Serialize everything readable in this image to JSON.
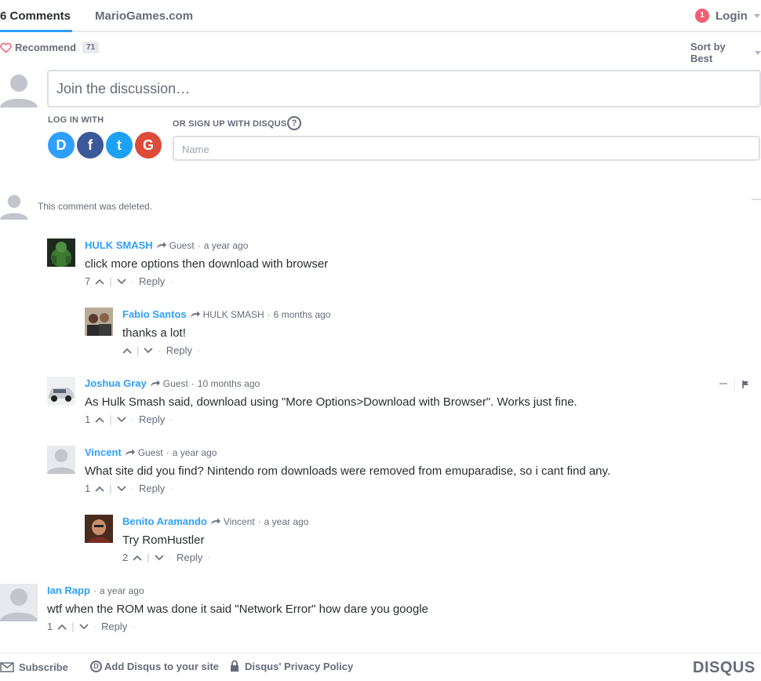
{
  "nav": {
    "comments_tab": "6 Comments",
    "site_tab": "MarioGames.com",
    "login_badge": "1",
    "login_label": "Login"
  },
  "toolbar": {
    "recommend_label": "Recommend",
    "recommend_count": "71",
    "sort_label": "Sort by Best"
  },
  "composer": {
    "placeholder": "Join the discussion…",
    "login_with": "LOG IN WITH",
    "signup_with": "OR SIGN UP WITH DISQUS",
    "help": "?",
    "name_placeholder": "Name",
    "social": [
      "D",
      "f",
      "t",
      "G"
    ]
  },
  "deleted": {
    "text": "This comment was deleted.",
    "collapse": "—"
  },
  "comments": [
    {
      "author": "HULK SMASH",
      "reply_to": "Guest",
      "time": "a year ago",
      "text": "click more options then download with browser",
      "votes": "7",
      "reply": "Reply"
    },
    {
      "author": "Fabio Santos",
      "reply_to": "HULK SMASH",
      "time": "6 months ago",
      "text": "thanks a lot!",
      "votes": "",
      "reply": "Reply"
    },
    {
      "author": "Joshua Gray",
      "reply_to": "Guest",
      "time": "10 months ago",
      "text": "As Hulk Smash said, download using \"More Options>Download with Browser\". Works just fine.",
      "votes": "1",
      "reply": "Reply"
    },
    {
      "author": "Vincent",
      "reply_to": "Guest",
      "time": "a year ago",
      "text": "What site did you find? Nintendo rom downloads were removed from emuparadise, so i cant find any.",
      "votes": "1",
      "reply": "Reply"
    },
    {
      "author": "Benito Aramando",
      "reply_to": "Vincent",
      "time": "a year ago",
      "text": "Try RomHustler",
      "votes": "2",
      "reply": "Reply"
    },
    {
      "author": "Ian Rapp",
      "reply_to": "",
      "time": "a year ago",
      "text": "wtf when the ROM was done it said \"Network Error\" how dare you google",
      "votes": "1",
      "reply": "Reply"
    }
  ],
  "footer": {
    "subscribe": "Subscribe",
    "add_disqus": "Add Disqus to your site",
    "privacy": "Disqus' Privacy Policy",
    "brand": "DISQUS"
  }
}
